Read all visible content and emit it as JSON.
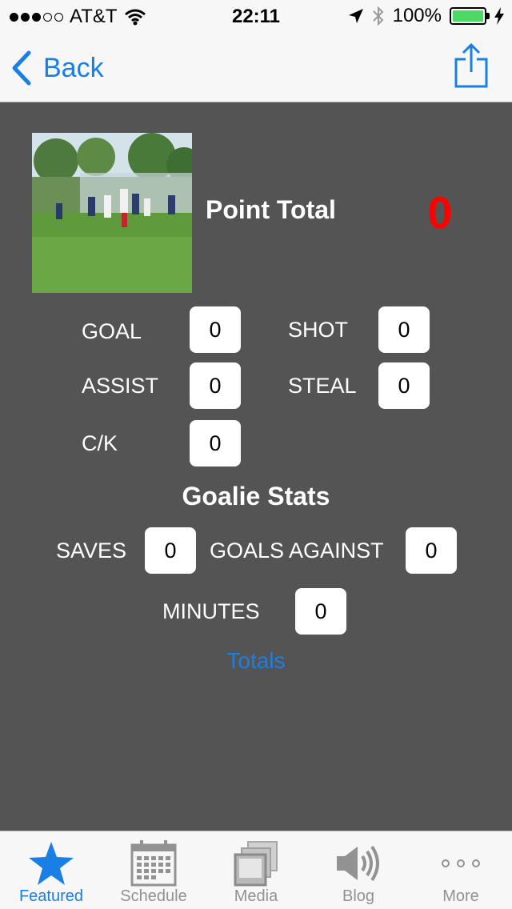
{
  "status_bar": {
    "carrier": "AT&T",
    "time": "22:11",
    "battery": "100%",
    "signal_bars_filled": 3,
    "signal_bars_total": 5
  },
  "nav": {
    "back_label": "Back"
  },
  "summary": {
    "point_total_label": "Point Total",
    "point_total_value": "0"
  },
  "stats": {
    "goal_label": "GOAL",
    "goal_value": "0",
    "shot_label": "SHOT",
    "shot_value": "0",
    "assist_label": "ASSIST",
    "assist_value": "0",
    "steal_label": "STEAL",
    "steal_value": "0",
    "ck_label": "C/K",
    "ck_value": "0"
  },
  "goalie": {
    "title": "Goalie Stats",
    "saves_label": "SAVES",
    "saves_value": "0",
    "goals_against_label": "GOALS AGAINST",
    "goals_against_value": "0",
    "minutes_label": "MINUTES",
    "minutes_value": "0"
  },
  "totals_link": "Totals",
  "tabbar": {
    "tabs": [
      {
        "label": "Featured",
        "icon": "star-icon",
        "active": true
      },
      {
        "label": "Schedule",
        "icon": "calendar-icon",
        "active": false
      },
      {
        "label": "Media",
        "icon": "media-icon",
        "active": false
      },
      {
        "label": "Blog",
        "icon": "speaker-icon",
        "active": false
      },
      {
        "label": "More",
        "icon": "more-icon",
        "active": false
      }
    ]
  },
  "colors": {
    "accent": "#1a7fe5",
    "background": "#545454",
    "point_total": "#ff0000"
  }
}
